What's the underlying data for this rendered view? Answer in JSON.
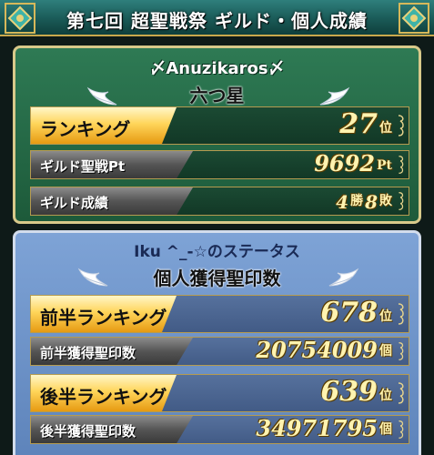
{
  "header": {
    "title": "第七回 超聖戦祭 ギルド・個人成績"
  },
  "guild": {
    "name": "〆Anuzikaros〆",
    "rank_title": "六つ星",
    "ranking_label": "ランキング",
    "ranking_value": "27",
    "ranking_unit": "位",
    "pt_label": "ギルド聖戦Pt",
    "pt_value": "9692",
    "pt_unit": "Pt",
    "result_label": "ギルド成績",
    "wins": "4",
    "wins_unit": "勝",
    "losses": "8",
    "losses_unit": "敗"
  },
  "personal": {
    "player_status": "Iku ^_-☆のステータス",
    "title": "個人獲得聖印数",
    "first_rank_label": "前半ランキング",
    "first_rank_value": "678",
    "first_rank_unit": "位",
    "first_seal_label": "前半獲得聖印数",
    "first_seal_value": "20754009",
    "first_seal_unit": "個",
    "second_rank_label": "後半ランキング",
    "second_rank_value": "639",
    "second_rank_unit": "位",
    "second_seal_label": "後半獲得聖印数",
    "second_seal_value": "34971795",
    "second_seal_unit": "個"
  },
  "colors": {
    "guild_panel": "#1d5a3a",
    "personal_panel": "#6e94c8",
    "gold_label": "#ffd55a",
    "value_text": "#fff3b0"
  },
  "icons": [
    "ornament-icon",
    "wing-icon",
    "scroll-ornament-icon"
  ]
}
